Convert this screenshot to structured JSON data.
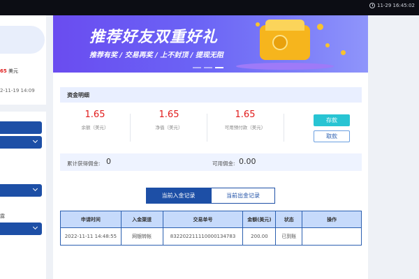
{
  "topbar": {
    "clock": "11-29 16:45:02"
  },
  "sidebar": {
    "balance_value": "65",
    "balance_unit": "美元",
    "date": "2-11-19 14:09",
    "label_1": "露"
  },
  "banner": {
    "title": "推荐好友双重好礼",
    "subtitle": "推荐有奖 / 交易再奖 / 上不封顶 / 提现无阻"
  },
  "funds": {
    "section_title": "资金明细",
    "stats": [
      {
        "value": "1.65",
        "label": "余额（美元）"
      },
      {
        "value": "1.65",
        "label": "净值（美元）"
      },
      {
        "value": "1.65",
        "label": "可用预付款（美元）"
      }
    ],
    "deposit_label": "存款",
    "withdraw_label": "取款",
    "total_commission_label": "累计获得佣金:",
    "total_commission_value": "0",
    "available_commission_label": "可用佣金:",
    "available_commission_value": "0.00"
  },
  "tabs": {
    "deposit_records": "当前入金记录",
    "withdraw_records": "当前出金记录"
  },
  "table": {
    "headers": [
      "申请时间",
      "入金渠道",
      "交易单号",
      "金额(美元)",
      "状态",
      "操作"
    ],
    "rows": [
      [
        "2022-11-11 14:48:55",
        "网银转帐",
        "832202211110000134783",
        "200.00",
        "已到账",
        ""
      ]
    ]
  }
}
